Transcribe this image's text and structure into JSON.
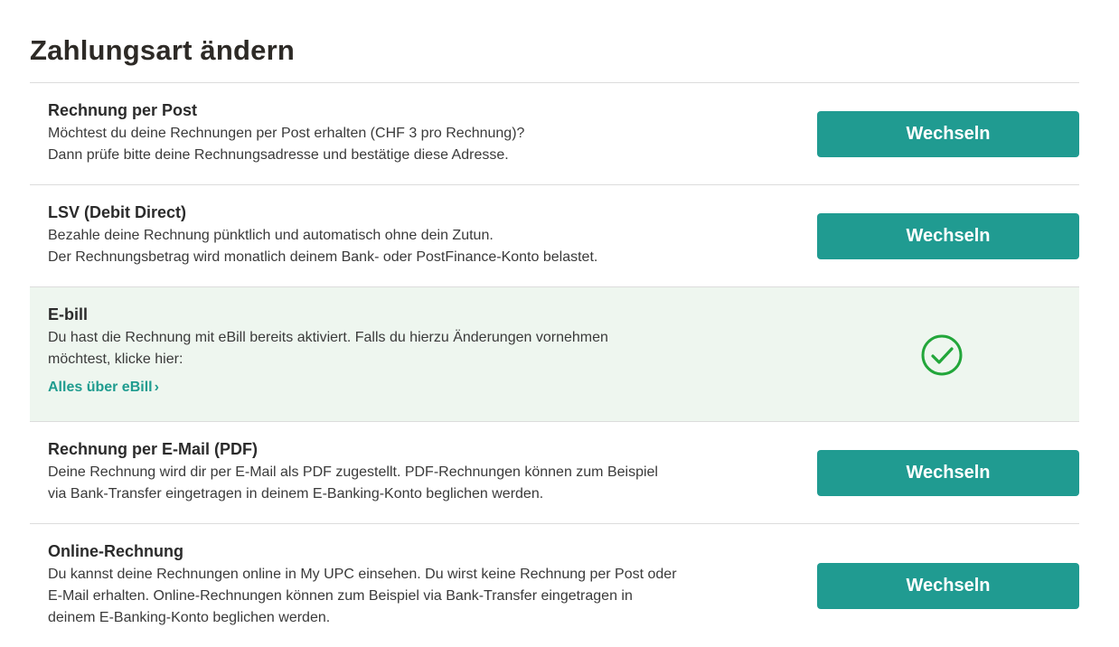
{
  "page_title": "Zahlungsart ändern",
  "accent_color": "#209b91",
  "options": [
    {
      "title": "Rechnung per Post",
      "description": "Möchtest du deine Rechnungen per Post erhalten (CHF 3 pro Rechnung)?\nDann prüfe bitte deine Rechnungsadresse und bestätige diese Adresse.",
      "button_label": "Wechseln"
    },
    {
      "title": "LSV (Debit Direct)",
      "description": "Bezahle deine Rechnung pünktlich und automatisch ohne dein Zutun.\nDer Rechnungsbetrag wird monatlich deinem Bank- oder PostFinance-Konto belastet.",
      "button_label": "Wechseln"
    },
    {
      "title": "E-bill",
      "description": "Du hast die Rechnung mit eBill bereits aktiviert. Falls du hierzu Änderungen vornehmen\nmöchtest, klicke hier:",
      "link_label": "Alles über eBill",
      "link_chevron": "›",
      "status_icon": "check-circle-icon",
      "active": true
    },
    {
      "title": "Rechnung per E-Mail (PDF)",
      "description": "Deine Rechnung wird dir per E-Mail als PDF zugestellt. PDF-Rechnungen können zum Beispiel\nvia Bank-Transfer eingetragen in deinem E-Banking-Konto beglichen werden.",
      "button_label": "Wechseln"
    },
    {
      "title": "Online-Rechnung",
      "description": "Du kannst deine Rechnungen online in My UPC einsehen. Du wirst keine Rechnung per Post oder\nE-Mail erhalten. Online-Rechnungen können zum Beispiel via Bank-Transfer eingetragen in\ndeinem E-Banking-Konto beglichen werden.",
      "button_label": "Wechseln"
    }
  ]
}
